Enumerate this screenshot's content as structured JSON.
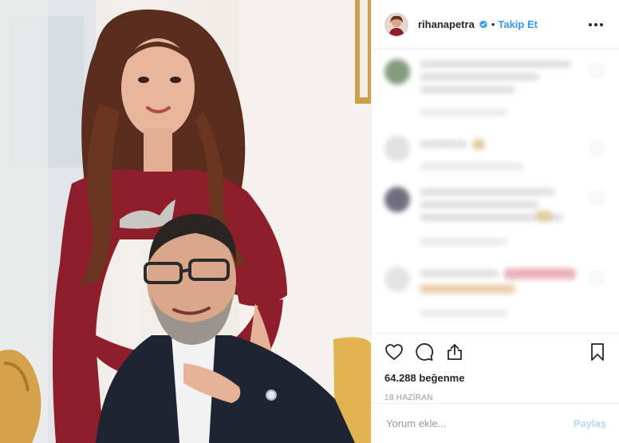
{
  "header": {
    "username": "rihanapetra",
    "separator": "•",
    "follow_label": "Takip Et"
  },
  "actions": {
    "likes_count": "64.288",
    "likes_label": "beğenme",
    "date": "18 HAZİRAN"
  },
  "comment_box": {
    "placeholder": "Yorum ekle...",
    "post_label": "Paylaş"
  },
  "icons": {
    "verified": "verified-badge-icon",
    "more": "more-options-icon",
    "like": "heart-icon",
    "comment": "comment-bubble-icon",
    "share": "share-upload-icon",
    "save": "bookmark-icon"
  },
  "colors": {
    "link": "#3897f0",
    "text": "#262626",
    "muted": "#999999",
    "post_disabled": "#b3dbff",
    "dress": "#8e1e2a"
  }
}
